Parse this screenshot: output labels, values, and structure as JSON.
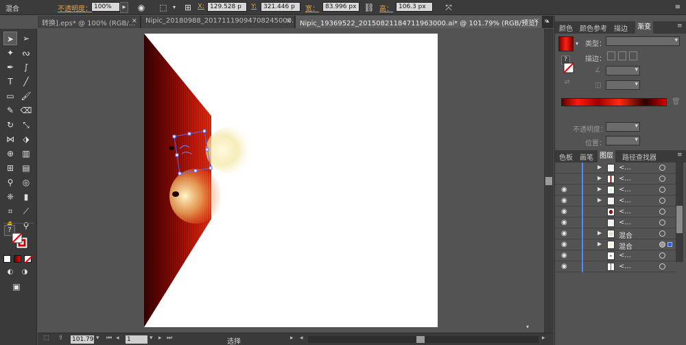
{
  "control_bar": {
    "blend_label": "混合",
    "opacity_label": "不透明度：",
    "opacity_value": "100%",
    "x_label": "X:",
    "x_value": "129.528 p",
    "y_label": "Y:",
    "y_value": "321.446 p",
    "width_label": "宽：",
    "width_value": "83.996 px",
    "height_label": "高：",
    "height_value": "106.3 px"
  },
  "tabs": [
    {
      "label": "转换].eps* @ 100% (RGB/..."
    },
    {
      "label": "Nipic_20180988_20171119094708245000.ai*"
    },
    {
      "label": "Nipic_19369522_20150821184711963000.ai* @ 101.79% (RGB/预览)"
    }
  ],
  "status_bar": {
    "zoom": "101.79",
    "page": "1",
    "tool": "选择"
  },
  "panel_top": {
    "tabs": [
      "颜色",
      "颜色参考",
      "描边",
      "渐变"
    ],
    "active_tab": "渐变",
    "type_label": "类型：",
    "stroke_label": "描边：",
    "opacity_label": "不透明度：",
    "position_label": "位置："
  },
  "panel_bottom": {
    "tabs": [
      "色板",
      "画笔",
      "图层",
      "路径查找器"
    ],
    "active_tab": "图层"
  },
  "layers": [
    {
      "name": "<...",
      "visible": false,
      "expandable": true
    },
    {
      "name": "<...",
      "visible": false,
      "expandable": true
    },
    {
      "name": "<...",
      "visible": true,
      "expandable": true
    },
    {
      "name": "<...",
      "visible": true,
      "expandable": true
    },
    {
      "name": "<...",
      "visible": true,
      "expandable": false
    },
    {
      "name": "<...",
      "visible": true,
      "expandable": false
    },
    {
      "name": "混合",
      "visible": true,
      "expandable": true
    },
    {
      "name": "混合",
      "visible": true,
      "expandable": true
    },
    {
      "name": "<...",
      "visible": true,
      "expandable": false
    },
    {
      "name": "<...",
      "visible": true,
      "expandable": false
    }
  ]
}
